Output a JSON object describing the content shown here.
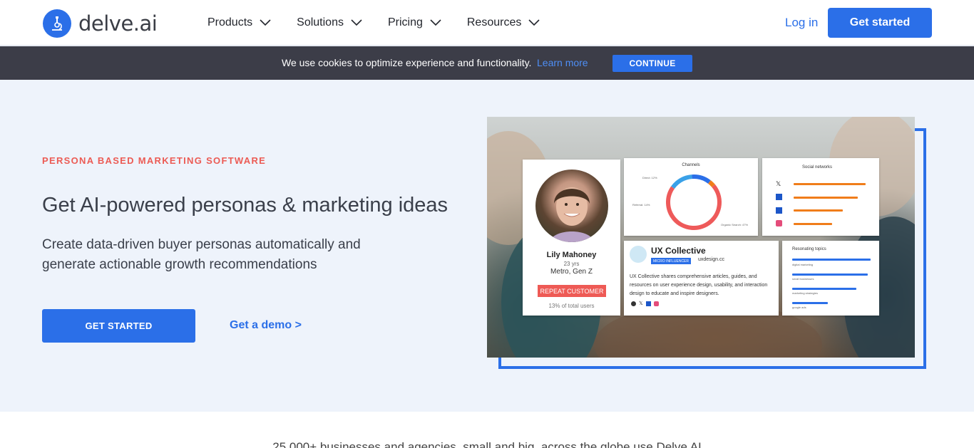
{
  "header": {
    "logo_text": "delve.ai",
    "nav": [
      {
        "label": "Products"
      },
      {
        "label": "Solutions"
      },
      {
        "label": "Pricing"
      },
      {
        "label": "Resources"
      }
    ],
    "login_label": "Log in",
    "cta_label": "Get started"
  },
  "cookie": {
    "text": "We use cookies to optimize experience and functionality.",
    "link": "Learn more",
    "button": "CONTINUE"
  },
  "hero": {
    "eyebrow": "PERSONA BASED MARKETING SOFTWARE",
    "headline": "Get AI-powered personas & marketing ideas",
    "subheadline": "Create data-driven buyer personas automatically and generate actionable growth recommendations",
    "primary_button": "GET STARTED",
    "secondary_link": "Get a demo >"
  },
  "illustration": {
    "persona": {
      "name": "Lily Mahoney",
      "age": "23 yrs",
      "segment": "Metro, Gen Z",
      "badge": "REPEAT CUSTOMER",
      "share": "13% of total users"
    },
    "channels": {
      "title": "Channels",
      "labels": [
        "Direct: 12%",
        "Referral: 14%",
        "Organic Search: 47%"
      ]
    },
    "social": {
      "title": "Social networks"
    },
    "influencer": {
      "name": "UX Collective",
      "badge": "MICRO INFLUENCER",
      "url": "uxdesign.cc",
      "description": "UX Collective shares comprehensive articles, guides, and resources on user experience design, usability, and interaction design to educate and inspire designers."
    },
    "topics": {
      "title": "Resonating topics",
      "items": [
        "digital marketing",
        "small businesses",
        "marketing strategies",
        "google ads"
      ]
    }
  },
  "bottom": {
    "text": "25,000+ businesses and agencies, small and big, across the globe use Delve AI"
  },
  "colors": {
    "accent": "#2b6fe8",
    "eyebrow": "#ec5b54",
    "cookie_bar": "#3c3d48",
    "hero_bg": "#eef3fb"
  }
}
